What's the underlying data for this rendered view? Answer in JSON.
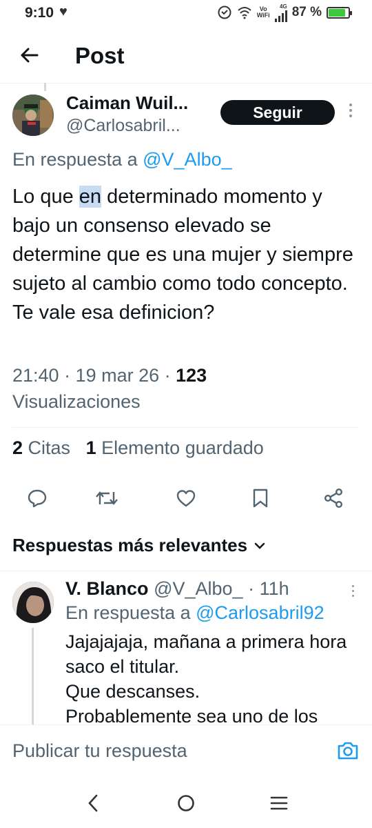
{
  "status_bar": {
    "time": "9:10",
    "network_top": "Vo",
    "network_bottom": "WiFi",
    "network_type": "4G",
    "battery": "87 %",
    "battery_level": 0.87,
    "battery_color": "#3bc93b"
  },
  "header": {
    "title": "Post",
    "back_icon": "arrow-left-icon"
  },
  "tweet": {
    "author_name": "Caiman Wuil...",
    "author_handle": "@Carlosabril...",
    "follow_label": "Seguir",
    "reply_prefix": "En respuesta a ",
    "reply_handle": "@V_Albo_",
    "text_before": "Lo que ",
    "text_highlight": "en",
    "text_after": " determinado momento y bajo un consenso elevado se determine que es una mujer y siempre sujeto al cambio como todo concepto. Te vale esa definicion?",
    "time": "21:40 · 19 mar 26 · ",
    "views_count": "123",
    "views_label": "Visualizaciones",
    "quotes_count": "2",
    "quotes_label": "Citas",
    "bookmarks_count": "1",
    "bookmarks_label": "Elemento guardado"
  },
  "actions": {
    "reply_icon": "reply-icon",
    "retweet_icon": "retweet-icon",
    "like_icon": "heart-icon",
    "bookmark_icon": "bookmark-icon",
    "share_icon": "share-icon"
  },
  "replies_filter": {
    "label": "Respuestas más relevantes"
  },
  "reply": {
    "name": "V. Blanco",
    "handle": "@V_Albo_",
    "time": "· 11h",
    "reply_prefix": "En respuesta a ",
    "reply_handle": "@Carlosabril92",
    "text_line1": "Jajajajaja, mañana a primera hora saco el titular.",
    "text_line2": "Que descanses.",
    "text_line3": "Probablemente sea uno de los"
  },
  "composer": {
    "placeholder": "Publicar tu respuesta"
  },
  "colors": {
    "accent": "#1d9bf0",
    "text": "#0f1419",
    "secondary": "#536471"
  }
}
